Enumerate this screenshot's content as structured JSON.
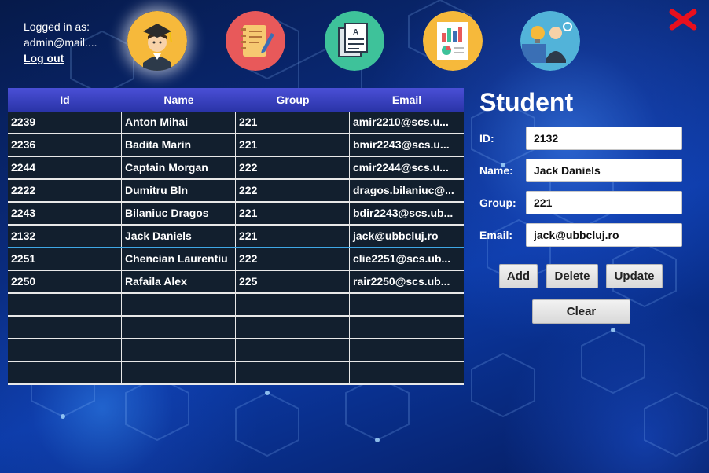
{
  "session": {
    "logged_in_label": "Logged in as:",
    "user_email": "admin@mail....",
    "logout_label": "Log out"
  },
  "nav": [
    {
      "name": "student-graduate-icon",
      "color": "#f6b93b",
      "active": true
    },
    {
      "name": "notebook-icon",
      "color": "#e8595a",
      "active": false
    },
    {
      "name": "documents-icon",
      "color": "#3ec29a",
      "active": false
    },
    {
      "name": "report-chart-icon",
      "color": "#f6b93b",
      "active": false
    },
    {
      "name": "business-idea-icon",
      "color": "#52b3d9",
      "active": false
    }
  ],
  "close_icon": {
    "name": "close-icon",
    "color": "#e8101e"
  },
  "table": {
    "columns": [
      "Id",
      "Name",
      "Group",
      "Email"
    ],
    "rows": [
      [
        "2239",
        "Anton Mihai",
        "221",
        "amir2210@scs.u..."
      ],
      [
        "2236",
        "Badita Marin",
        "221",
        "bmir2243@scs.u..."
      ],
      [
        "2244",
        "Captain Morgan",
        "222",
        "cmir2244@scs.u..."
      ],
      [
        "2222",
        "Dumitru Bln",
        "222",
        "dragos.bilaniuc@..."
      ],
      [
        "2243",
        "Bilaniuc Dragos",
        "221",
        "bdir2243@scs.ub..."
      ],
      [
        "2132",
        "Jack Daniels",
        "221",
        "jack@ubbcluj.ro"
      ],
      [
        "2251",
        "Chencian Laurentiu",
        "222",
        "clie2251@scs.ub..."
      ],
      [
        "2250",
        "Rafaila Alex",
        "225",
        "rair2250@scs.ub..."
      ]
    ],
    "empty_rows": 4,
    "selected_row_index": 5,
    "header_color": "#3a40c4",
    "selection_color": "#3ea7e6"
  },
  "form": {
    "title": "Student",
    "id_label": "ID:",
    "id_value": "2132",
    "name_label": "Name:",
    "name_value": "Jack Daniels",
    "group_label": "Group:",
    "group_value": "221",
    "email_label": "Email:",
    "email_value": "jack@ubbcluj.ro"
  },
  "buttons": {
    "add": "Add",
    "delete": "Delete",
    "update": "Update",
    "clear": "Clear"
  }
}
